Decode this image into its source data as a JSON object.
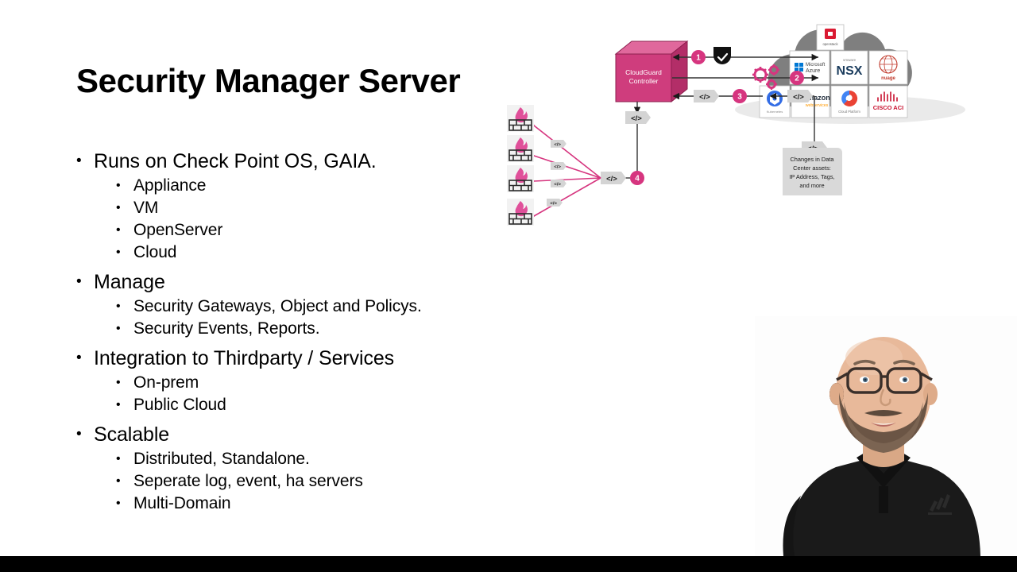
{
  "slide": {
    "title": "Security Manager Server",
    "background_color": "#ffffff",
    "bottom_bar_color": "#000000"
  },
  "bullets": [
    {
      "text": "Runs on Check Point OS, GAIA.",
      "children": [
        "Appliance",
        "VM",
        "OpenServer",
        "Cloud"
      ]
    },
    {
      "text": "Manage",
      "children": [
        "Security Gateways, Object and Policys.",
        "Security Events, Reports."
      ]
    },
    {
      "text": "Integration to Thirdparty / Services",
      "children": [
        "On-prem",
        "Public Cloud"
      ]
    },
    {
      "text": "Scalable",
      "children": [
        "Distributed, Standalone.",
        "Seperate log, event, ha servers",
        "Multi-Domain"
      ]
    }
  ],
  "bullet_glyph": "•",
  "diagram": {
    "controller": {
      "line1": "CloudGuard",
      "line2": "Controller",
      "fill": "#cf3d7d",
      "top_fill": "#e0689c",
      "side_fill": "#b32e68"
    },
    "accent_color": "#d6357f",
    "tag_label": "</>",
    "tag_fill": "#d4d4d4",
    "steps": [
      {
        "id": "1",
        "label": "1"
      },
      {
        "id": "2",
        "label": "2"
      },
      {
        "id": "3",
        "label": "3"
      },
      {
        "id": "4",
        "label": "4"
      }
    ],
    "callout": {
      "lines": [
        "Changes in Data",
        "Center assets:",
        "IP Address, Tags,",
        "and more"
      ],
      "fill": "#d9d9d9"
    },
    "cloud": {
      "fill": "#7f7f7f",
      "tiles": [
        {
          "name": "OpenStack",
          "short": "openstack",
          "color": "#da1a32"
        },
        {
          "name": "Microsoft Azure",
          "short": "Microsoft",
          "sub": "Azure",
          "color": "#0078d4"
        },
        {
          "name": "VMware NSX",
          "short": "NSX",
          "sub": "vmware",
          "color": "#1b3c5d"
        },
        {
          "name": "Nuage Networks",
          "short": "nuage",
          "sub": "networks",
          "color": "#c0392b"
        },
        {
          "name": "Kubernetes",
          "short": "Kubernetes",
          "color": "#326ce5"
        },
        {
          "name": "Amazon Web Services",
          "short": "amazon",
          "sub": "webservices",
          "color": "#ff9900"
        },
        {
          "name": "Google Cloud Platform",
          "short": "Google",
          "sub": "Cloud Platform",
          "color": "#ea4335"
        },
        {
          "name": "CISCO ACI",
          "short": "CISCO ACI",
          "color": "#c8102e"
        }
      ]
    },
    "firewalls_count": 4,
    "firewall_flame_color": "#e0509a",
    "gear_color": "#d6357f",
    "shield_color": "#111111"
  },
  "presenter": {
    "description": "Presenter webcam overlay",
    "skin": "#e8b99a",
    "shirt": "#1a1a1a",
    "beard": "#6b5545",
    "glasses": "#3a2f2a",
    "background": "#fdfdfd"
  }
}
